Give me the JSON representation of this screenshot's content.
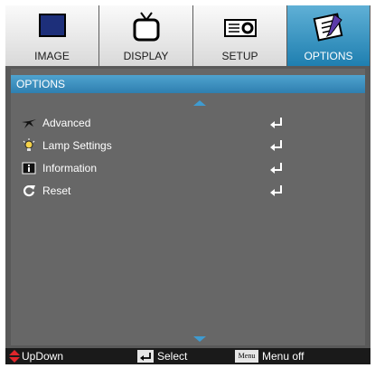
{
  "tabs": [
    {
      "label": "IMAGE",
      "icon": "monitor-icon"
    },
    {
      "label": "DISPLAY",
      "icon": "tv-icon"
    },
    {
      "label": "SETUP",
      "icon": "projector-icon"
    },
    {
      "label": "OPTIONS",
      "icon": "notepad-pencil-icon",
      "active": true
    }
  ],
  "panel": {
    "title": "OPTIONS",
    "items": [
      {
        "label": "Advanced",
        "icon": "star-icon"
      },
      {
        "label": "Lamp Settings",
        "icon": "lightbulb-icon"
      },
      {
        "label": "Information",
        "icon": "info-icon"
      },
      {
        "label": "Reset",
        "icon": "reset-icon"
      }
    ]
  },
  "footer": {
    "updown": "UpDown",
    "select": "Select",
    "menu_key": "Menu",
    "menu_off": "Menu off"
  },
  "colors": {
    "accent": "#2f7fb0",
    "panel": "#676767",
    "frame": "#595959"
  }
}
